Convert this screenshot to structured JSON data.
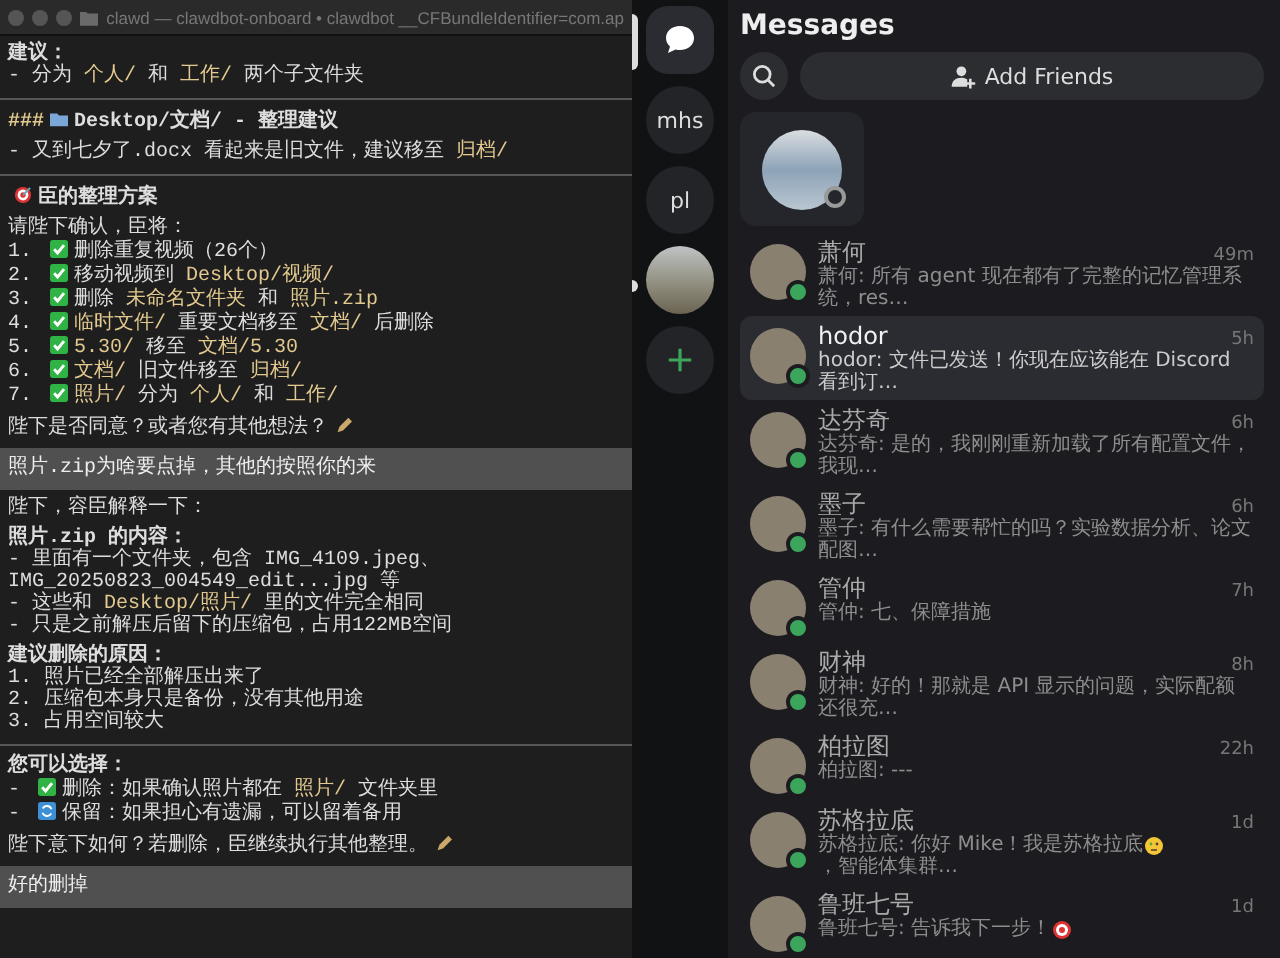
{
  "terminal": {
    "title": "clawd — clawdbot-onboard • clawdbot __CFBundleIdentifier=com.ap",
    "blocks": [
      {
        "kind": "line",
        "bold": true,
        "parts": [
          {
            "kind": "text",
            "text": "建议："
          }
        ]
      },
      {
        "kind": "line",
        "bold": false,
        "parts": [
          {
            "kind": "text",
            "text": "- 分为 "
          },
          {
            "kind": "path",
            "text": "个人/"
          },
          {
            "kind": "text",
            "text": " 和 "
          },
          {
            "kind": "path",
            "text": "工作/"
          },
          {
            "kind": "text",
            "text": " 两个子文件夹"
          }
        ]
      },
      {
        "kind": "rule"
      },
      {
        "kind": "line",
        "bold": true,
        "parts": [
          {
            "kind": "path",
            "text": "###"
          },
          {
            "kind": "folder"
          },
          {
            "kind": "text",
            "text": "Desktop/文档/ - 整理建议"
          }
        ]
      },
      {
        "kind": "gap"
      },
      {
        "kind": "line",
        "bold": false,
        "parts": [
          {
            "kind": "text",
            "text": "- 又到七夕了.docx 看起来是旧文件，建议移至 "
          },
          {
            "kind": "path",
            "text": "归档/"
          }
        ]
      },
      {
        "kind": "rule"
      },
      {
        "kind": "line",
        "bold": true,
        "parts": [
          {
            "kind": "target"
          },
          {
            "kind": "text",
            "text": "臣的整理方案"
          }
        ]
      },
      {
        "kind": "gap"
      },
      {
        "kind": "line",
        "bold": false,
        "parts": [
          {
            "kind": "text",
            "text": "请陛下确认，臣将："
          }
        ]
      },
      {
        "kind": "line",
        "bold": false,
        "parts": [
          {
            "kind": "text",
            "text": "1. "
          },
          {
            "kind": "check"
          },
          {
            "kind": "text",
            "text": "删除重复视频（26个）"
          }
        ]
      },
      {
        "kind": "line",
        "bold": false,
        "parts": [
          {
            "kind": "text",
            "text": "2. "
          },
          {
            "kind": "check"
          },
          {
            "kind": "text",
            "text": "移动视频到 "
          },
          {
            "kind": "path",
            "text": "Desktop/视频/"
          }
        ]
      },
      {
        "kind": "line",
        "bold": false,
        "parts": [
          {
            "kind": "text",
            "text": "3. "
          },
          {
            "kind": "check"
          },
          {
            "kind": "text",
            "text": "删除 "
          },
          {
            "kind": "path",
            "text": "未命名文件夹"
          },
          {
            "kind": "text",
            "text": " 和 "
          },
          {
            "kind": "path",
            "text": "照片.zip"
          }
        ]
      },
      {
        "kind": "line",
        "bold": false,
        "parts": [
          {
            "kind": "text",
            "text": "4. "
          },
          {
            "kind": "check"
          },
          {
            "kind": "path",
            "text": "临时文件/"
          },
          {
            "kind": "text",
            "text": " 重要文档移至 "
          },
          {
            "kind": "path",
            "text": "文档/"
          },
          {
            "kind": "text",
            "text": " 后删除"
          }
        ]
      },
      {
        "kind": "line",
        "bold": false,
        "parts": [
          {
            "kind": "text",
            "text": "5. "
          },
          {
            "kind": "check"
          },
          {
            "kind": "path",
            "text": "5.30/"
          },
          {
            "kind": "text",
            "text": " 移至 "
          },
          {
            "kind": "path",
            "text": "文档/5.30"
          }
        ]
      },
      {
        "kind": "line",
        "bold": false,
        "parts": [
          {
            "kind": "text",
            "text": "6. "
          },
          {
            "kind": "check"
          },
          {
            "kind": "path",
            "text": "文档/"
          },
          {
            "kind": "text",
            "text": " 旧文件移至 "
          },
          {
            "kind": "path",
            "text": "归档/"
          }
        ]
      },
      {
        "kind": "line",
        "bold": false,
        "parts": [
          {
            "kind": "text",
            "text": "7. "
          },
          {
            "kind": "check"
          },
          {
            "kind": "path",
            "text": "照片/"
          },
          {
            "kind": "text",
            "text": " 分为 "
          },
          {
            "kind": "path",
            "text": "个人/"
          },
          {
            "kind": "text",
            "text": " 和 "
          },
          {
            "kind": "path",
            "text": "工作/"
          }
        ]
      },
      {
        "kind": "gap"
      },
      {
        "kind": "line",
        "bold": false,
        "parts": [
          {
            "kind": "text",
            "text": "陛下是否同意？或者您有其他想法？"
          },
          {
            "kind": "writing"
          }
        ]
      },
      {
        "kind": "user",
        "text": "照片.zip为啥要点掉，其他的按照你的来"
      },
      {
        "kind": "line",
        "bold": false,
        "parts": [
          {
            "kind": "text",
            "text": "陛下，容臣解释一下："
          }
        ]
      },
      {
        "kind": "gap"
      },
      {
        "kind": "line",
        "bold": true,
        "parts": [
          {
            "kind": "text",
            "text": "照片.zip 的内容："
          }
        ]
      },
      {
        "kind": "line",
        "bold": false,
        "parts": [
          {
            "kind": "text",
            "text": "- 里面有一个文件夹，包含 IMG_4109.jpeg、IMG_20250823_004549_edit...jpg 等"
          }
        ]
      },
      {
        "kind": "line",
        "bold": false,
        "parts": [
          {
            "kind": "text",
            "text": "- 这些和 "
          },
          {
            "kind": "path",
            "text": "Desktop/照片/"
          },
          {
            "kind": "text",
            "text": " 里的文件完全相同"
          }
        ]
      },
      {
        "kind": "line",
        "bold": false,
        "parts": [
          {
            "kind": "text",
            "text": "- 只是之前解压后留下的压缩包，占用122MB空间"
          }
        ]
      },
      {
        "kind": "gap"
      },
      {
        "kind": "line",
        "bold": true,
        "parts": [
          {
            "kind": "text",
            "text": "建议删除的原因："
          }
        ]
      },
      {
        "kind": "line",
        "bold": false,
        "parts": [
          {
            "kind": "text",
            "text": "1. 照片已经全部解压出来了"
          }
        ]
      },
      {
        "kind": "line",
        "bold": false,
        "parts": [
          {
            "kind": "text",
            "text": "2. 压缩包本身只是备份，没有其他用途"
          }
        ]
      },
      {
        "kind": "line",
        "bold": false,
        "parts": [
          {
            "kind": "text",
            "text": "3. 占用空间较大"
          }
        ]
      },
      {
        "kind": "rule"
      },
      {
        "kind": "line",
        "bold": true,
        "parts": [
          {
            "kind": "text",
            "text": "您可以选择："
          }
        ]
      },
      {
        "kind": "line",
        "bold": false,
        "parts": [
          {
            "kind": "text",
            "text": "- "
          },
          {
            "kind": "check"
          },
          {
            "kind": "text",
            "text": "删除：如果确认照片都在 "
          },
          {
            "kind": "path",
            "text": "照片/"
          },
          {
            "kind": "text",
            "text": " 文件夹里"
          }
        ]
      },
      {
        "kind": "line",
        "bold": false,
        "parts": [
          {
            "kind": "text",
            "text": "- "
          },
          {
            "kind": "cycle"
          },
          {
            "kind": "text",
            "text": "保留：如果担心有遗漏，可以留着备用"
          }
        ]
      },
      {
        "kind": "gap"
      },
      {
        "kind": "line",
        "bold": false,
        "parts": [
          {
            "kind": "text",
            "text": "陛下意下如何？若删除，臣继续执行其他整理。"
          },
          {
            "kind": "writing"
          }
        ]
      },
      {
        "kind": "user",
        "text": "好的删掉"
      }
    ]
  },
  "servers": [
    {
      "kind": "dm",
      "selected": true,
      "unread": false
    },
    {
      "kind": "text",
      "label": "mhs",
      "selected": false,
      "unread": false
    },
    {
      "kind": "text",
      "label": "pl",
      "selected": false,
      "unread": false
    },
    {
      "kind": "photo",
      "selected": false,
      "unread": true
    },
    {
      "kind": "add",
      "selected": false,
      "unread": false
    }
  ],
  "messages": {
    "title": "Messages",
    "add_friends": "Add Friends",
    "dms": [
      {
        "name": "萧何",
        "time": "49m",
        "online": true,
        "selected": false,
        "preview": [
          {
            "kind": "text",
            "text": "萧何: 所有 agent 现在都有了完整的记忆管理系统，res…"
          }
        ]
      },
      {
        "name": "hodor",
        "time": "5h",
        "online": true,
        "selected": true,
        "preview": [
          {
            "kind": "text",
            "text": "hodor: 文件已发送！你现在应该能在 Discord 看到订…"
          }
        ]
      },
      {
        "name": "达芬奇",
        "time": "6h",
        "online": true,
        "selected": false,
        "preview": [
          {
            "kind": "text",
            "text": "达芬奇: 是的，我刚刚重新加载了所有配置文件，我现…"
          }
        ]
      },
      {
        "name": "墨子",
        "time": "6h",
        "online": true,
        "selected": false,
        "preview": [
          {
            "kind": "text",
            "text": "墨子: 有什么需要帮忙的吗？实验数据分析、论文配图…"
          }
        ]
      },
      {
        "name": "管仲",
        "time": "7h",
        "online": true,
        "selected": false,
        "preview": [
          {
            "kind": "text",
            "text": "管仲: 七、保障措施"
          }
        ]
      },
      {
        "name": "财神",
        "time": "8h",
        "online": true,
        "selected": false,
        "preview": [
          {
            "kind": "text",
            "text": "财神: 好的！那就是 API 显示的问题，实际配额还很充…"
          }
        ]
      },
      {
        "name": "柏拉图",
        "time": "22h",
        "online": true,
        "selected": false,
        "preview": [
          {
            "kind": "text",
            "text": "柏拉图: ---"
          }
        ]
      },
      {
        "name": "苏格拉底",
        "time": "1d",
        "online": true,
        "selected": false,
        "preview": [
          {
            "kind": "text",
            "text": "苏格拉底: 你好 Mike！我是苏格拉底 "
          },
          {
            "kind": "face"
          },
          {
            "kind": "text",
            "text": "，智能体集群…"
          }
        ]
      },
      {
        "name": "鲁班七号",
        "time": "1d",
        "online": true,
        "selected": false,
        "preview": [
          {
            "kind": "text",
            "text": "鲁班七号: 告诉我下一步！"
          },
          {
            "kind": "target"
          }
        ]
      }
    ]
  }
}
